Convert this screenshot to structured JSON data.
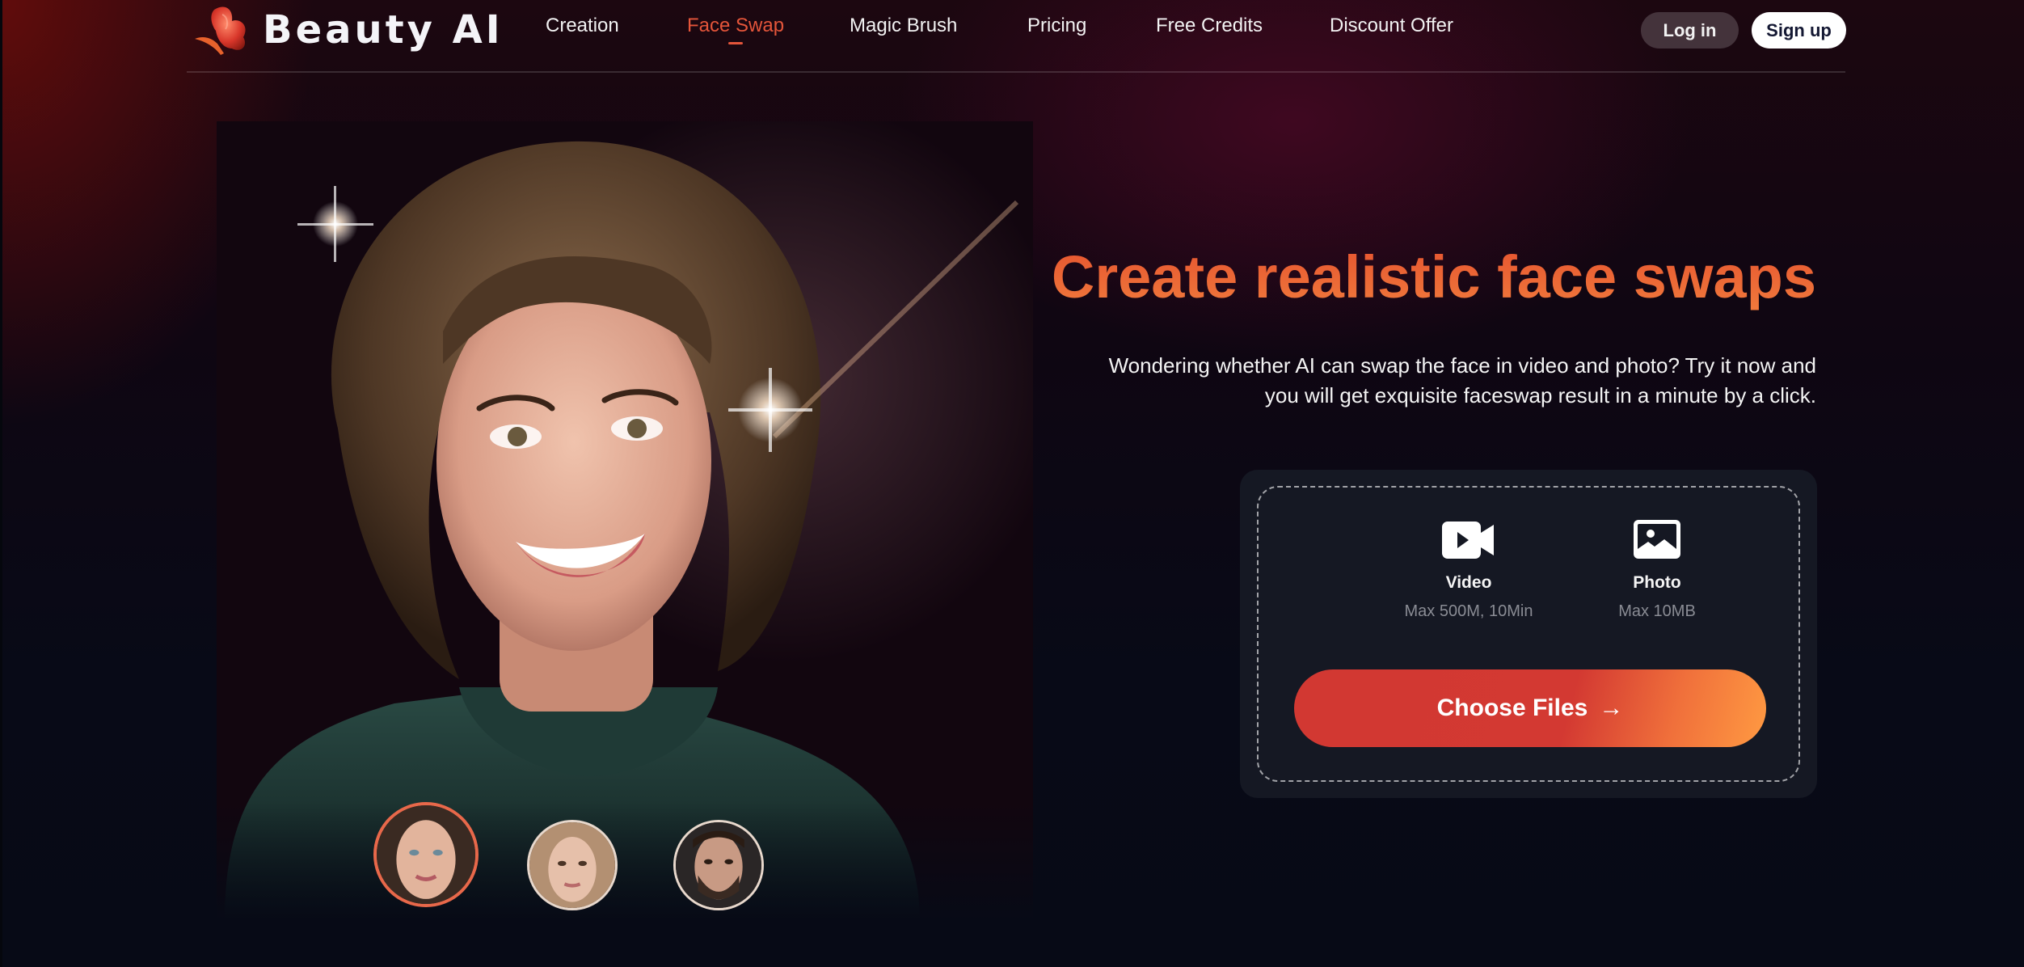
{
  "brand": {
    "name": "Beauty AI",
    "accent": "#e4553a"
  },
  "nav": {
    "items": [
      {
        "label": "Creation",
        "active": false
      },
      {
        "label": "Face Swap",
        "active": true
      },
      {
        "label": "Magic Brush",
        "active": false
      },
      {
        "label": "Pricing",
        "active": false
      },
      {
        "label": "Free Credits",
        "active": false
      },
      {
        "label": "Discount Offer",
        "active": false
      }
    ],
    "login_label": "Log in",
    "signup_label": "Sign up"
  },
  "hero": {
    "headline": "Create realistic face swaps",
    "subtitle": "Wondering whether AI can swap the face in video and photo? Try it now and you will get exquisite faceswap result in a minute by a click.",
    "face_thumbnails": [
      {
        "name": "woman-brunette",
        "selected": true
      },
      {
        "name": "woman-blonde",
        "selected": false
      },
      {
        "name": "man-bearded",
        "selected": false
      }
    ]
  },
  "upload": {
    "types": [
      {
        "icon": "video-camera-icon",
        "label": "Video",
        "limit": "Max 500M, 10Min"
      },
      {
        "icon": "image-icon",
        "label": "Photo",
        "limit": "Max 10MB"
      }
    ],
    "button_label": "Choose Files",
    "button_arrow": "→"
  }
}
